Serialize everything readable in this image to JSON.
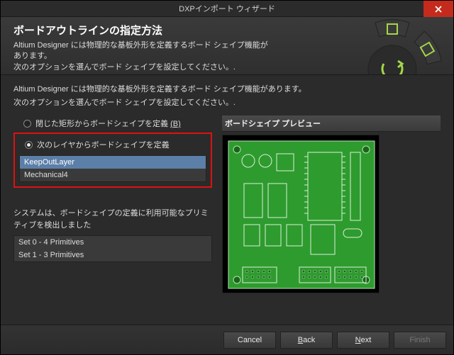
{
  "title": "DXPインポート ウィザード",
  "header": {
    "heading": "ボードアウトラインの指定方法",
    "desc1": "Altium Designer には物理的な基板外形を定義するボード シェイプ機能があります。",
    "desc2": "次のオプションを選んでボード シェイプを設定してください。."
  },
  "intro1": "Altium Designer には物理的な基板外形を定義するボード シェイプ機能があります。",
  "intro2": "次のオプションを選んでボード シェイプを設定してください。.",
  "radio1": {
    "label": "閉じた矩形からボードシェイプを定義 ",
    "mnemonic": "(B)"
  },
  "radio2": {
    "label": "次のレイヤからボードシェイプを定義"
  },
  "layers": {
    "0": "KeepOutLayer",
    "1": "Mechanical4"
  },
  "detected": "システムは、ボードシェイプの定義に利用可能なプリミティブを検出しました",
  "sets": {
    "0": "Set 0 - 4 Primitives",
    "1": "Set 1 - 3 Primitives"
  },
  "preview_title": "ボードシェイプ プレビュー",
  "footer": {
    "cancel": "Cancel",
    "back": "Back",
    "next": "Next",
    "finish": "Finish"
  }
}
